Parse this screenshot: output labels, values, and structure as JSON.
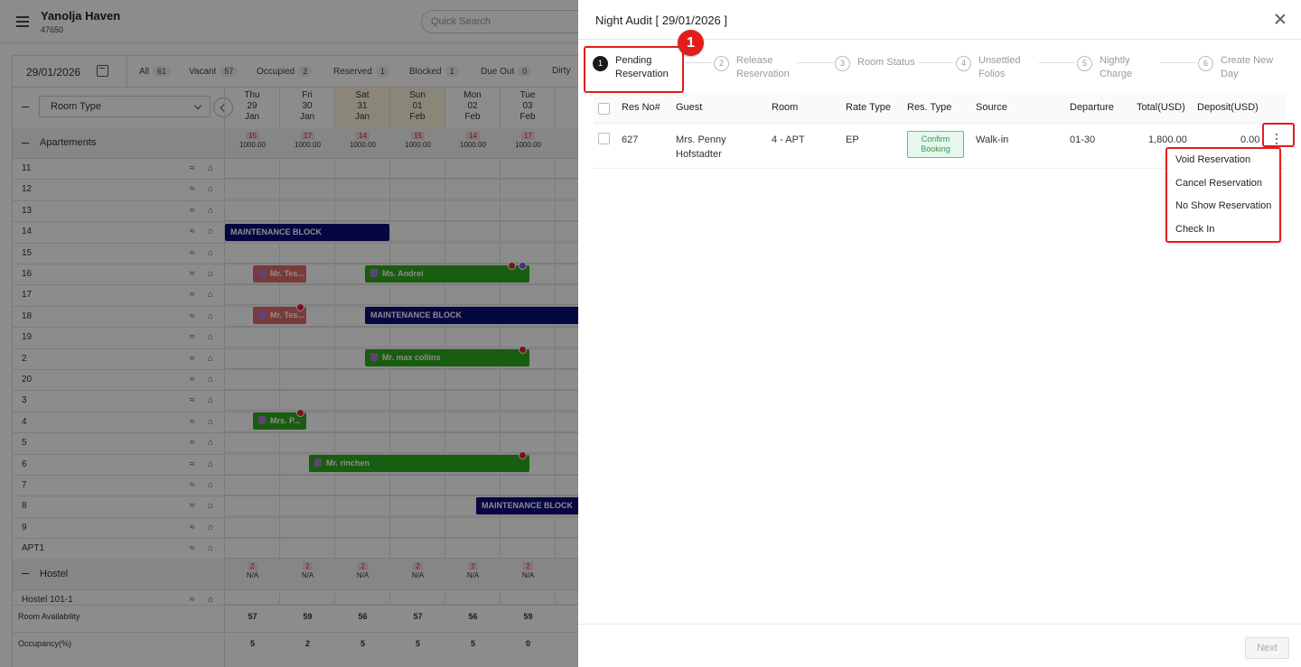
{
  "header": {
    "title": "Yanolja Haven",
    "property_id": "47650",
    "search_placeholder": "Quick Search"
  },
  "toolbar": {
    "date": "29/01/2026",
    "filters": [
      {
        "label": "All",
        "count": "61"
      },
      {
        "label": "Vacant",
        "count": "57"
      },
      {
        "label": "Occupied",
        "count": "2"
      },
      {
        "label": "Reserved",
        "count": "1"
      },
      {
        "label": "Blocked",
        "count": "1"
      },
      {
        "label": "Due Out",
        "count": "0"
      },
      {
        "label": "Dirty",
        "count": ""
      }
    ]
  },
  "grid": {
    "room_type_label": "Room Type",
    "days": [
      {
        "dow": "Thu",
        "day": "29",
        "mon": "Jan"
      },
      {
        "dow": "Fri",
        "day": "30",
        "mon": "Jan"
      },
      {
        "dow": "Sat",
        "day": "31",
        "mon": "Jan"
      },
      {
        "dow": "Sun",
        "day": "01",
        "mon": "Feb"
      },
      {
        "dow": "Mon",
        "day": "02",
        "mon": "Feb"
      },
      {
        "dow": "Tue",
        "day": "03",
        "mon": "Feb"
      }
    ],
    "sections": {
      "apartments": {
        "name": "Apartements",
        "availability": [
          "15",
          "17",
          "14",
          "15",
          "14",
          "17"
        ],
        "rate": [
          "1000.00",
          "1000.00",
          "1000.00",
          "1000.00",
          "1000.00",
          "1000.00"
        ]
      },
      "hostel": {
        "name": "Hostel",
        "availability": [
          "2",
          "2",
          "2",
          "2",
          "2",
          "2"
        ],
        "rate": [
          "N/A",
          "N/A",
          "N/A",
          "N/A",
          "N/A",
          "N/A"
        ]
      }
    },
    "rooms": [
      "11",
      "12",
      "13",
      "14",
      "15",
      "16",
      "17",
      "18",
      "19",
      "2",
      "20",
      "3",
      "4",
      "5",
      "6",
      "7",
      "8",
      "9",
      "APT1"
    ],
    "hostel_rooms": [
      "Hostel 101-1"
    ],
    "bars": {
      "r14": "MAINTENANCE BLOCK",
      "r16a": "Mr. Tes...",
      "r16b": "Ms. Andrei",
      "r18a": "Mr. Tes...",
      "r18b": "MAINTENANCE BLOCK",
      "r2": "Mr. max collins",
      "r4": "Mrs. P...",
      "r6": "Mr. rinchen",
      "r8": "MAINTENANCE BLOCK"
    },
    "footer": {
      "availability_label": "Room Availability",
      "availability": [
        "57",
        "59",
        "56",
        "57",
        "56",
        "59"
      ],
      "occupancy_label": "Occupancy(%)",
      "occupancy": [
        "5",
        "2",
        "5",
        "5",
        "5",
        "0"
      ]
    }
  },
  "drawer": {
    "title": "Night Audit [ 29/01/2026 ]",
    "steps": [
      {
        "num": "1",
        "line1": "Pending",
        "line2": "Reservation"
      },
      {
        "num": "2",
        "line1": "Release",
        "line2": "Reservation"
      },
      {
        "num": "3",
        "line1": "Room Status",
        "line2": ""
      },
      {
        "num": "4",
        "line1": "Unsettled",
        "line2": "Folios"
      },
      {
        "num": "5",
        "line1": "Nightly",
        "line2": "Charge"
      },
      {
        "num": "6",
        "line1": "Create New",
        "line2": "Day"
      }
    ],
    "annotation": "1",
    "columns": [
      "Res No#",
      "Guest",
      "Room",
      "Rate Type",
      "Res. Type",
      "Source",
      "Departure",
      "Total(USD)",
      "Deposit(USD)"
    ],
    "row": {
      "res_no": "627",
      "guest_line1": "Mrs. Penny",
      "guest_line2": "Hofstadter",
      "room": "4 - APT",
      "rate_type": "EP",
      "res_type_line1": "Confirm",
      "res_type_line2": "Booking",
      "source": "Walk-in",
      "departure": "01-30",
      "total": "1,800.00",
      "deposit": "0.00"
    },
    "menu": [
      "Void Reservation",
      "Cancel Reservation",
      "No Show Reservation",
      "Check In"
    ],
    "next_label": "Next"
  },
  "colors": {
    "maintenance": "#0b0b7a",
    "checked_in": "#2eaa1e",
    "reserved": "#e06b6b",
    "highlight": "#e21d1d"
  }
}
